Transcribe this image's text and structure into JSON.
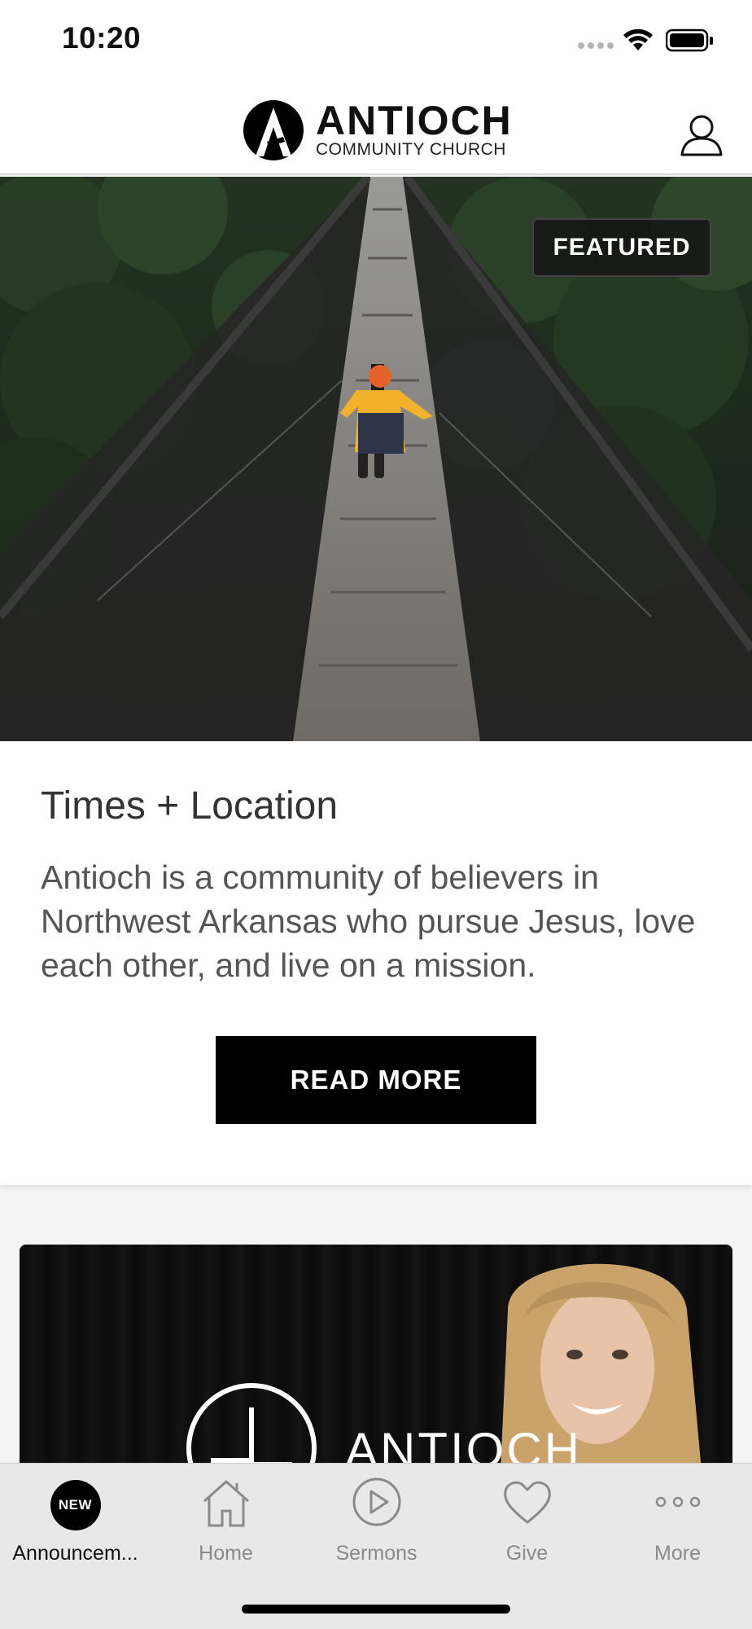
{
  "status_bar": {
    "time": "10:20"
  },
  "header": {
    "logo_name": "ANTIOCH",
    "logo_sub": "COMMUNITY CHURCH"
  },
  "featured": {
    "badge": "FEATURED",
    "title": "Times + Location",
    "description": "Antioch is a community of believers in Northwest Arkansas who pursue Jesus, love each other, and live on a mission.",
    "button_label": "READ MORE"
  },
  "second_card": {
    "overlay_text": "ANTIOCH"
  },
  "tab_bar": {
    "tabs": [
      {
        "label": "Announcem...",
        "icon": "new-badge",
        "badge": "NEW",
        "active": true
      },
      {
        "label": "Home",
        "icon": "home-icon",
        "active": false
      },
      {
        "label": "Sermons",
        "icon": "play-icon",
        "active": false
      },
      {
        "label": "Give",
        "icon": "heart-icon",
        "active": false
      },
      {
        "label": "More",
        "icon": "more-icon",
        "active": false
      }
    ]
  },
  "colors": {
    "accent": "#000000",
    "inactive_tab": "#8a8a8a",
    "tab_bar_bg": "#e8e8e8"
  }
}
